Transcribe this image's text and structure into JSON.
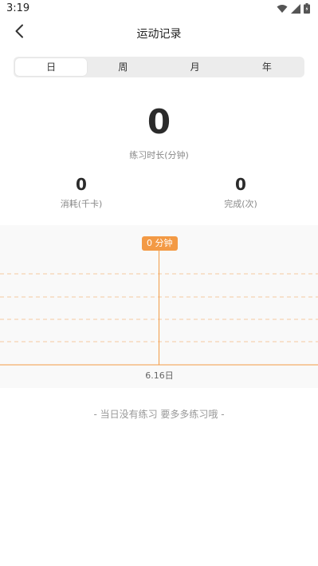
{
  "status_bar": {
    "time": "3:19",
    "icons": [
      "wifi-icon",
      "cellular-signal-icon",
      "battery-icon"
    ]
  },
  "nav": {
    "title": "运动记录",
    "back_icon": "chevron-left-icon"
  },
  "tabs": [
    {
      "label": "日",
      "active": true
    },
    {
      "label": "周",
      "active": false
    },
    {
      "label": "月",
      "active": false
    },
    {
      "label": "年",
      "active": false
    }
  ],
  "summary": {
    "duration_value": "0",
    "duration_label": "练习时长(分钟)",
    "calories_value": "0",
    "calories_label": "消耗(千卡)",
    "completed_value": "0",
    "completed_label": "完成(次)"
  },
  "chart_data": {
    "type": "bar",
    "categories": [
      "6.16日"
    ],
    "values": [
      0
    ],
    "tooltip": "0 分钟",
    "colors": {
      "accent": "#f39a45",
      "grid": "#f5c9a0"
    }
  },
  "empty_message": "- 当日没有练习 要多多练习哦 -"
}
